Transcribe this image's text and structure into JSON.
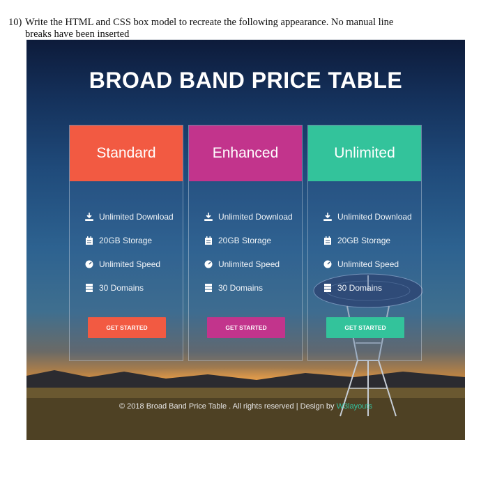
{
  "question": {
    "number": "10)",
    "line1": "Write the HTML and CSS box model to recreate the following appearance.  No manual line",
    "line2": "breaks have been inserted"
  },
  "page_title": "BROAD BAND PRICE TABLE",
  "plans": [
    {
      "name": "Standard",
      "color": "#f25a42",
      "features": [
        {
          "icon": "download-icon",
          "text": "Unlimited Download"
        },
        {
          "icon": "calendar-icon",
          "text": "20GB Storage"
        },
        {
          "icon": "speed-icon",
          "text": "Unlimited Speed"
        },
        {
          "icon": "server-icon",
          "text": "30 Domains"
        }
      ],
      "button": "GET STARTED"
    },
    {
      "name": "Enhanced",
      "color": "#c2348c",
      "features": [
        {
          "icon": "download-icon",
          "text": "Unlimited Download"
        },
        {
          "icon": "calendar-icon",
          "text": "20GB Storage"
        },
        {
          "icon": "speed-icon",
          "text": "Unlimited Speed"
        },
        {
          "icon": "server-icon",
          "text": "30 Domains"
        }
      ],
      "button": "GET STARTED"
    },
    {
      "name": "Unlimited",
      "color": "#33c39b",
      "features": [
        {
          "icon": "download-icon",
          "text": "Unlimited Download"
        },
        {
          "icon": "calendar-icon",
          "text": "20GB Storage"
        },
        {
          "icon": "speed-icon",
          "text": "Unlimited Speed"
        },
        {
          "icon": "server-icon",
          "text": "30 Domains"
        }
      ],
      "button": "GET STARTED"
    }
  ],
  "footer": {
    "text": "© 2018 Broad Band Price Table . All rights reserved | Design by ",
    "link": "W3layouts"
  }
}
